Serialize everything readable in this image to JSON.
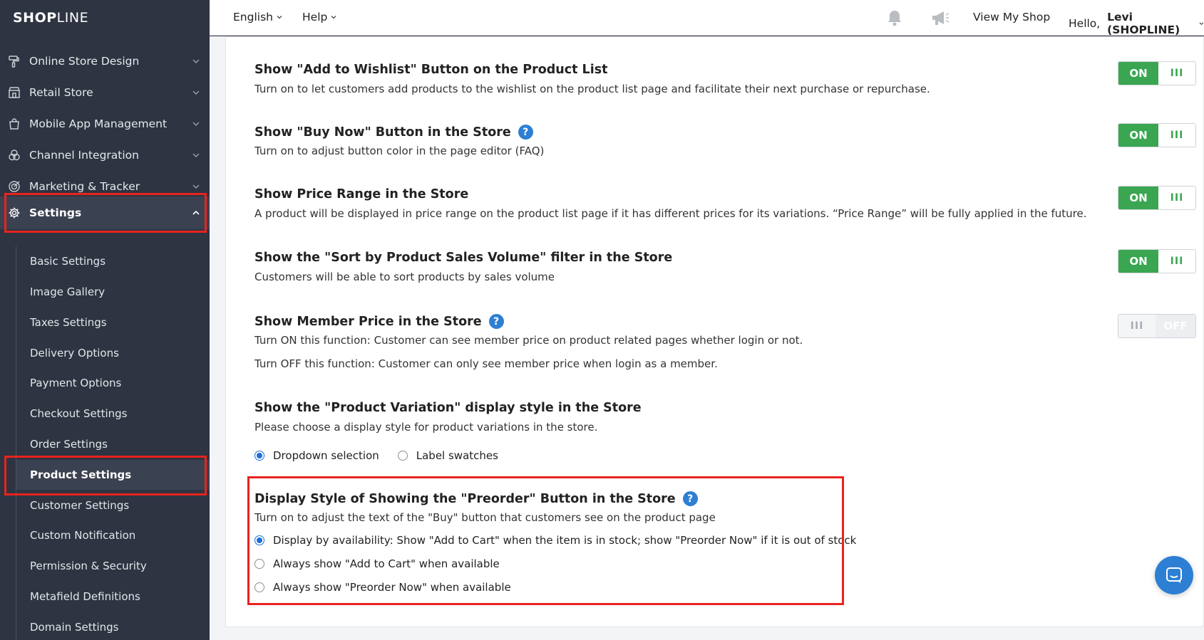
{
  "brand": {
    "logo_bold": "SHOP",
    "logo_light": "LINE"
  },
  "topbar": {
    "language": "English",
    "help": "Help",
    "view_shop": "View My Shop",
    "hello_prefix": "Hello, ",
    "user": "Levi (SHOPLINE)"
  },
  "sidebar": {
    "items": [
      {
        "label": "Online Store Design",
        "icon": "paint-roller-icon"
      },
      {
        "label": "Retail Store",
        "icon": "storefront-icon"
      },
      {
        "label": "Mobile App Management",
        "icon": "shopping-bag-icon"
      },
      {
        "label": "Channel Integration",
        "icon": "circles-icon"
      },
      {
        "label": "Marketing & Tracker",
        "icon": "target-icon"
      },
      {
        "label": "Settings",
        "icon": "gear-icon"
      }
    ],
    "subitems": [
      "Basic Settings",
      "Image Gallery",
      "Taxes Settings",
      "Delivery Options",
      "Payment Options",
      "Checkout Settings",
      "Order Settings",
      "Product Settings",
      "Customer Settings",
      "Custom Notification",
      "Permission & Security",
      "Metafield Definitions",
      "Domain Settings"
    ],
    "active_item": "Settings",
    "active_subitem": "Product Settings"
  },
  "settings": [
    {
      "title": "Show \"Add to Wishlist\" Button on the Product List",
      "desc": "Turn on to let customers add products to the wishlist on the product list page and facilitate their next purchase or repurchase.",
      "toggle": "ON"
    },
    {
      "title": "Show \"Buy Now\" Button in the Store",
      "desc": "Turn on to adjust button color in the page editor (FAQ)",
      "toggle": "ON"
    },
    {
      "title": "Show Price Range in the Store",
      "desc": "A product will be displayed in price range on the product list page if it has different prices for its variations. “Price Range” will be fully applied in the future.",
      "toggle": "ON"
    },
    {
      "title": "Show the \"Sort by Product Sales Volume\" filter in the Store",
      "desc": "Customers will be able to sort products by sales volume",
      "toggle": "ON"
    },
    {
      "title": "Show Member Price in the Store",
      "desc": "Turn ON this function: Customer can see member price on product related pages whether login or not.",
      "desc2": "Turn OFF this function: Customer can only see member price when login as a member.",
      "toggle": "OFF"
    }
  ],
  "variation": {
    "title": "Show the \"Product Variation\" display style in the Store",
    "desc": "Please choose a display style for product variations in the store.",
    "options": [
      "Dropdown selection",
      "Label swatches"
    ],
    "selected": "Dropdown selection"
  },
  "preorder": {
    "title": "Display Style of Showing the \"Preorder\" Button in the Store",
    "desc": "Turn on to adjust the text of the \"Buy\" button that customers see on the product page",
    "options": [
      "Display by availability: Show \"Add to Cart\" when the item is in stock; show \"Preorder Now\" if it is out of stock",
      "Always show \"Add to Cart\" when available",
      "Always show \"Preorder Now\" when available"
    ],
    "selected": "Display by availability: Show \"Add to Cart\" when the item is in stock; show \"Preorder Now\" if it is out of stock"
  },
  "colors": {
    "accent": "#3aa651",
    "highlight": "#e8231f",
    "sidebar": "#2e3441",
    "link": "#2d7fd3"
  }
}
